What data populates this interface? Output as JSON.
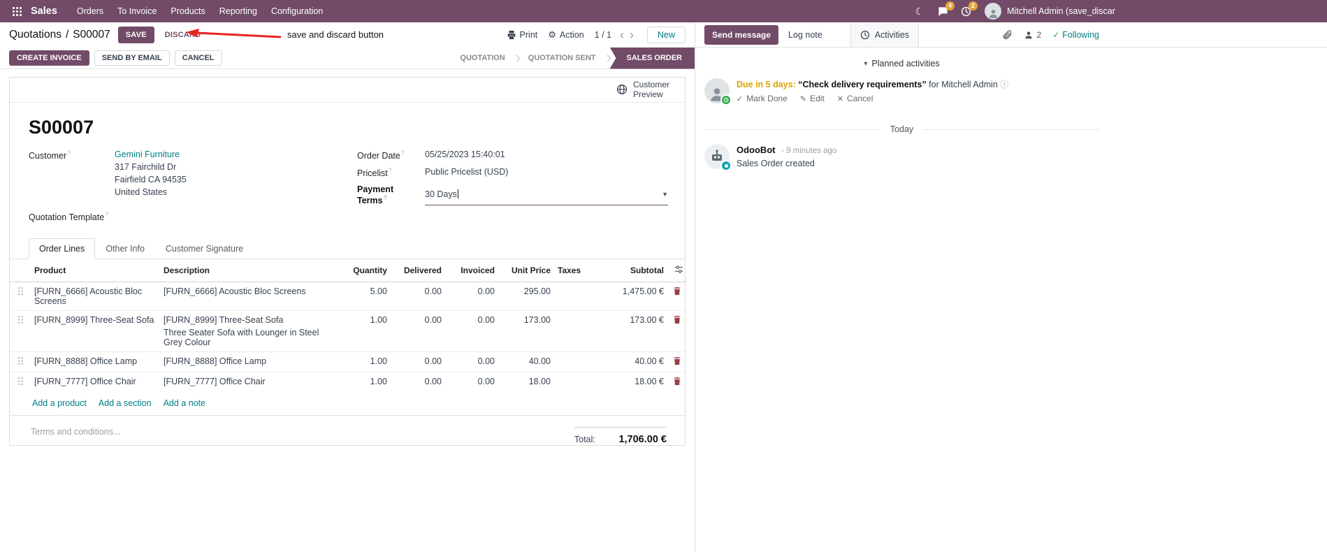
{
  "colors": {
    "brand": "#714B67",
    "link": "#017e84",
    "modified_value": "#2e6fd4",
    "activity_due": "#d9a300",
    "notification_badge": "#e9a23b",
    "success": "#28a745",
    "trash": "#9c3f46",
    "annotation_arrow": "#e8251f"
  },
  "topbar": {
    "app_name": "Sales",
    "menus": [
      "Orders",
      "To Invoice",
      "Products",
      "Reporting",
      "Configuration"
    ],
    "messages_badge": "4",
    "activities_badge": "2",
    "user_name": "Mitchell Admin (save_discar"
  },
  "control_panel": {
    "breadcrumb_parent": "Quotations",
    "breadcrumb_separator": "/",
    "breadcrumb_current": "S00007",
    "save_label": "SAVE",
    "discard_label": "DISCARD",
    "annotation_text": "save and discard button",
    "print_label": "Print",
    "action_label": "Action",
    "pager_value": "1 / 1",
    "new_label": "New"
  },
  "statusbar": {
    "create_invoice": "CREATE INVOICE",
    "send_by_email": "SEND BY EMAIL",
    "cancel": "CANCEL",
    "states": [
      "QUOTATION",
      "QUOTATION SENT",
      "SALES ORDER"
    ],
    "active_state": "SALES ORDER"
  },
  "sheet": {
    "customer_preview": "Customer Preview",
    "title": "S00007",
    "help_marker": "?",
    "fields": {
      "customer_label": "Customer",
      "customer_value": "Gemini Furniture",
      "address_line1": "317 Fairchild Dr",
      "address_line2": "Fairfield CA 94535",
      "address_line3": "United States",
      "order_date_label": "Order Date",
      "order_date_value": "05/25/2023 15:40:01",
      "pricelist_label": "Pricelist",
      "pricelist_value": "Public Pricelist (USD)",
      "payment_terms_label": "Payment Terms",
      "payment_terms_value": "30 Days",
      "quotation_template_label": "Quotation Template"
    },
    "tabs": [
      "Order Lines",
      "Other Info",
      "Customer Signature"
    ],
    "table": {
      "headers": {
        "product": "Product",
        "description": "Description",
        "quantity": "Quantity",
        "delivered": "Delivered",
        "invoiced": "Invoiced",
        "unit_price": "Unit Price",
        "taxes": "Taxes",
        "subtotal": "Subtotal"
      },
      "rows": [
        {
          "product": "[FURN_6666] Acoustic Bloc Screens",
          "description": "[FURN_6666] Acoustic Bloc Screens",
          "quantity": "5.00",
          "delivered": "0.00",
          "invoiced": "0.00",
          "unit_price": "295.00",
          "taxes": "",
          "subtotal": "1,475.00 €"
        },
        {
          "product": "[FURN_8999] Three-Seat Sofa",
          "description": "[FURN_8999] Three-Seat Sofa",
          "description_line2": "Three Seater Sofa with Lounger in Steel Grey Colour",
          "quantity": "1.00",
          "delivered": "0.00",
          "invoiced": "0.00",
          "unit_price": "173.00",
          "taxes": "",
          "subtotal": "173.00 €"
        },
        {
          "product": "[FURN_8888] Office Lamp",
          "description": "[FURN_8888] Office Lamp",
          "quantity": "1.00",
          "delivered": "0.00",
          "invoiced": "0.00",
          "unit_price": "40.00",
          "taxes": "",
          "subtotal": "40.00 €"
        },
        {
          "product": "[FURN_7777] Office Chair",
          "description": "[FURN_7777] Office Chair",
          "quantity": "1.00",
          "delivered": "0.00",
          "invoiced": "0.00",
          "unit_price": "18.00",
          "taxes": "",
          "subtotal": "18.00 €"
        }
      ],
      "add_product": "Add a product",
      "add_section": "Add a section",
      "add_note": "Add a note"
    },
    "terms_placeholder": "Terms and conditions...",
    "total_label": "Total:",
    "total_value": "1,706.00 €"
  },
  "chatter": {
    "send_message": "Send message",
    "log_note": "Log note",
    "activities_tab": "Activities",
    "followers_count": "2",
    "following_label": "Following",
    "planned_activities_header": "Planned activities",
    "activity": {
      "due": "Due in 5 days:",
      "summary": "“Check delivery requirements”",
      "assignee": "for Mitchell Admin",
      "mark_done": "Mark Done",
      "edit": "Edit",
      "cancel": "Cancel"
    },
    "date_divider": "Today",
    "message": {
      "author": "OdooBot",
      "timestamp": "- 9 minutes ago",
      "body": "Sales Order created"
    }
  }
}
